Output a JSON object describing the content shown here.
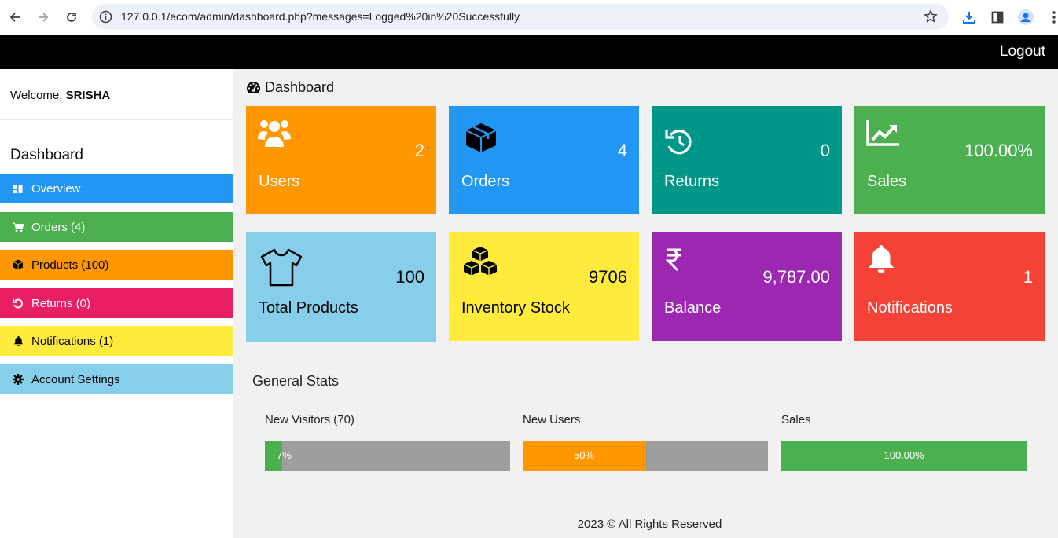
{
  "browser": {
    "url": "127.0.0.1/ecom/admin/dashboard.php?messages=Logged%20in%20Successfully",
    "icons": [
      "back-arrow-icon",
      "forward-arrow-icon",
      "reload-icon",
      "site-info-icon",
      "bookmark-star-icon",
      "download-icon",
      "side-panel-icon",
      "profile-icon",
      "more-menu-icon"
    ]
  },
  "topbar": {
    "logout_label": "Logout"
  },
  "sidebar": {
    "welcome_prefix": "Welcome, ",
    "username": "SRISHA",
    "heading": "Dashboard",
    "items": [
      {
        "label": "Overview",
        "icon": "grid-icon",
        "color": "#2196f3",
        "text_color": "#ffffff"
      },
      {
        "label": "Orders (4)",
        "icon": "cart-icon",
        "color": "#4caf50",
        "text_color": "#ffffff"
      },
      {
        "label": "Products (100)",
        "icon": "cube-icon",
        "color": "#ff9800",
        "text_color": "#000000"
      },
      {
        "label": "Returns (0)",
        "icon": "undo-icon",
        "color": "#e91e63",
        "text_color": "#ffffff"
      },
      {
        "label": "Notifications (1)",
        "icon": "bell-icon",
        "color": "#ffeb3b",
        "text_color": "#000000"
      },
      {
        "label": "Account Settings",
        "icon": "gear-icon",
        "color": "#87ceeb",
        "text_color": "#000000"
      }
    ]
  },
  "main": {
    "title": "Dashboard",
    "title_icon": "tachometer-icon",
    "cards": [
      {
        "label": "Users",
        "value": "2",
        "icon": "users-icon",
        "color": "#ff9800",
        "text_color": "#ffffff"
      },
      {
        "label": "Orders",
        "value": "4",
        "icon": "cubes-box-icon",
        "color": "#2196f3",
        "text_color": "#ffffff"
      },
      {
        "label": "Returns",
        "value": "0",
        "icon": "history-icon",
        "color": "#009688",
        "text_color": "#ffffff"
      },
      {
        "label": "Sales",
        "value": "100.00%",
        "icon": "line-chart-icon",
        "color": "#4caf50",
        "text_color": "#ffffff"
      },
      {
        "label": "Total Products",
        "value": "100",
        "icon": "tshirt-icon",
        "color": "#87ceeb",
        "text_color": "#000000"
      },
      {
        "label": "Inventory Stock",
        "value": "9706",
        "icon": "cubes-icon",
        "color": "#ffeb3b",
        "text_color": "#000000"
      },
      {
        "label": "Balance",
        "value": "9,787.00",
        "icon": "rupee-icon",
        "color": "#9c27b0",
        "text_color": "#ffffff"
      },
      {
        "label": "Notifications",
        "value": "1",
        "icon": "bell-icon",
        "color": "#f44336",
        "text_color": "#ffffff"
      }
    ],
    "stats": {
      "title": "General Stats",
      "items": [
        {
          "label": "New Visitors (70)",
          "bar_text": "7%",
          "percent": 7,
          "color": "#4caf50"
        },
        {
          "label": "New Users",
          "bar_text": "50%",
          "percent": 50,
          "color": "#ff9800"
        },
        {
          "label": "Sales",
          "bar_text": "100.00%",
          "percent": 100,
          "color": "#4caf50"
        }
      ]
    },
    "footer": "2023 © All Rights Reserved"
  }
}
